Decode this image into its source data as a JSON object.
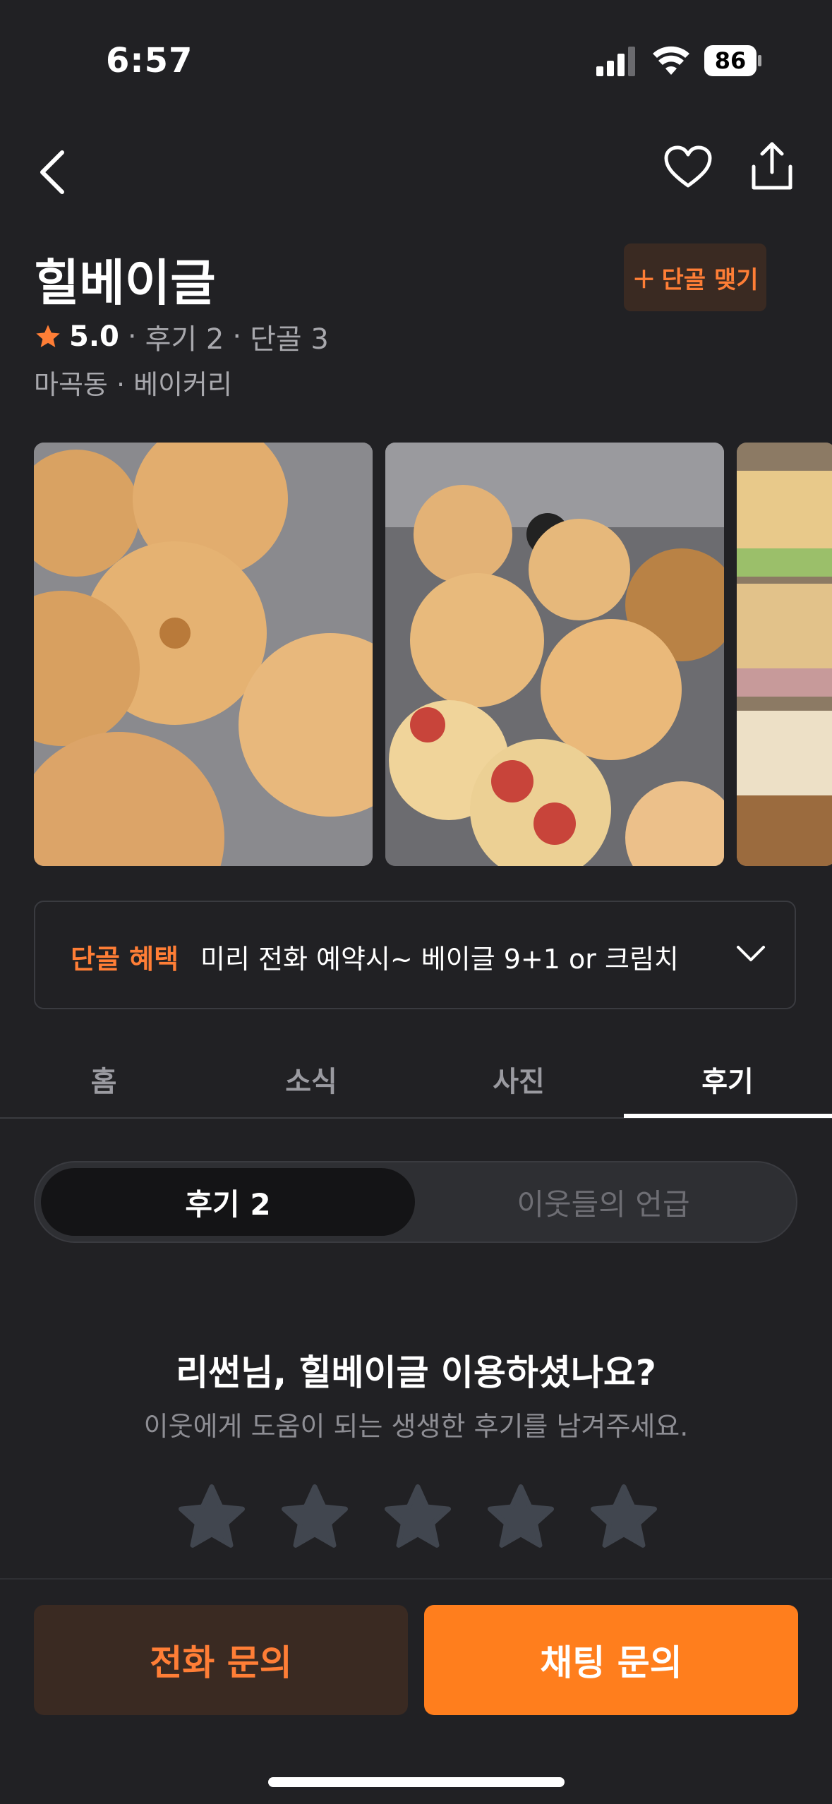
{
  "status_bar": {
    "time": "6:57",
    "battery": "86"
  },
  "store": {
    "name": "힐베이글",
    "join_label": "단골 맺기",
    "rating": "5.0",
    "reviews": "후기 2",
    "regulars": "단골 3",
    "location": "마곡동 · 베이커리"
  },
  "benefit": {
    "tag": "단골 혜택",
    "text": "미리 전화 예약시~ 베이글 9+1 or 크림치"
  },
  "tabs": [
    {
      "label": "홈"
    },
    {
      "label": "소식"
    },
    {
      "label": "사진"
    },
    {
      "label": "후기"
    }
  ],
  "segment": {
    "active": "후기 2",
    "inactive": "이웃들의 언급"
  },
  "prompt": {
    "title": "리썬님, 힐베이글 이용하셨나요?",
    "subtitle": "이웃에게 도움이 되는 생생한 후기를 남겨주세요."
  },
  "buttons": {
    "call": "전화 문의",
    "chat": "채팅 문의"
  },
  "colors": {
    "accent": "#ff7e36",
    "background": "#212124"
  }
}
